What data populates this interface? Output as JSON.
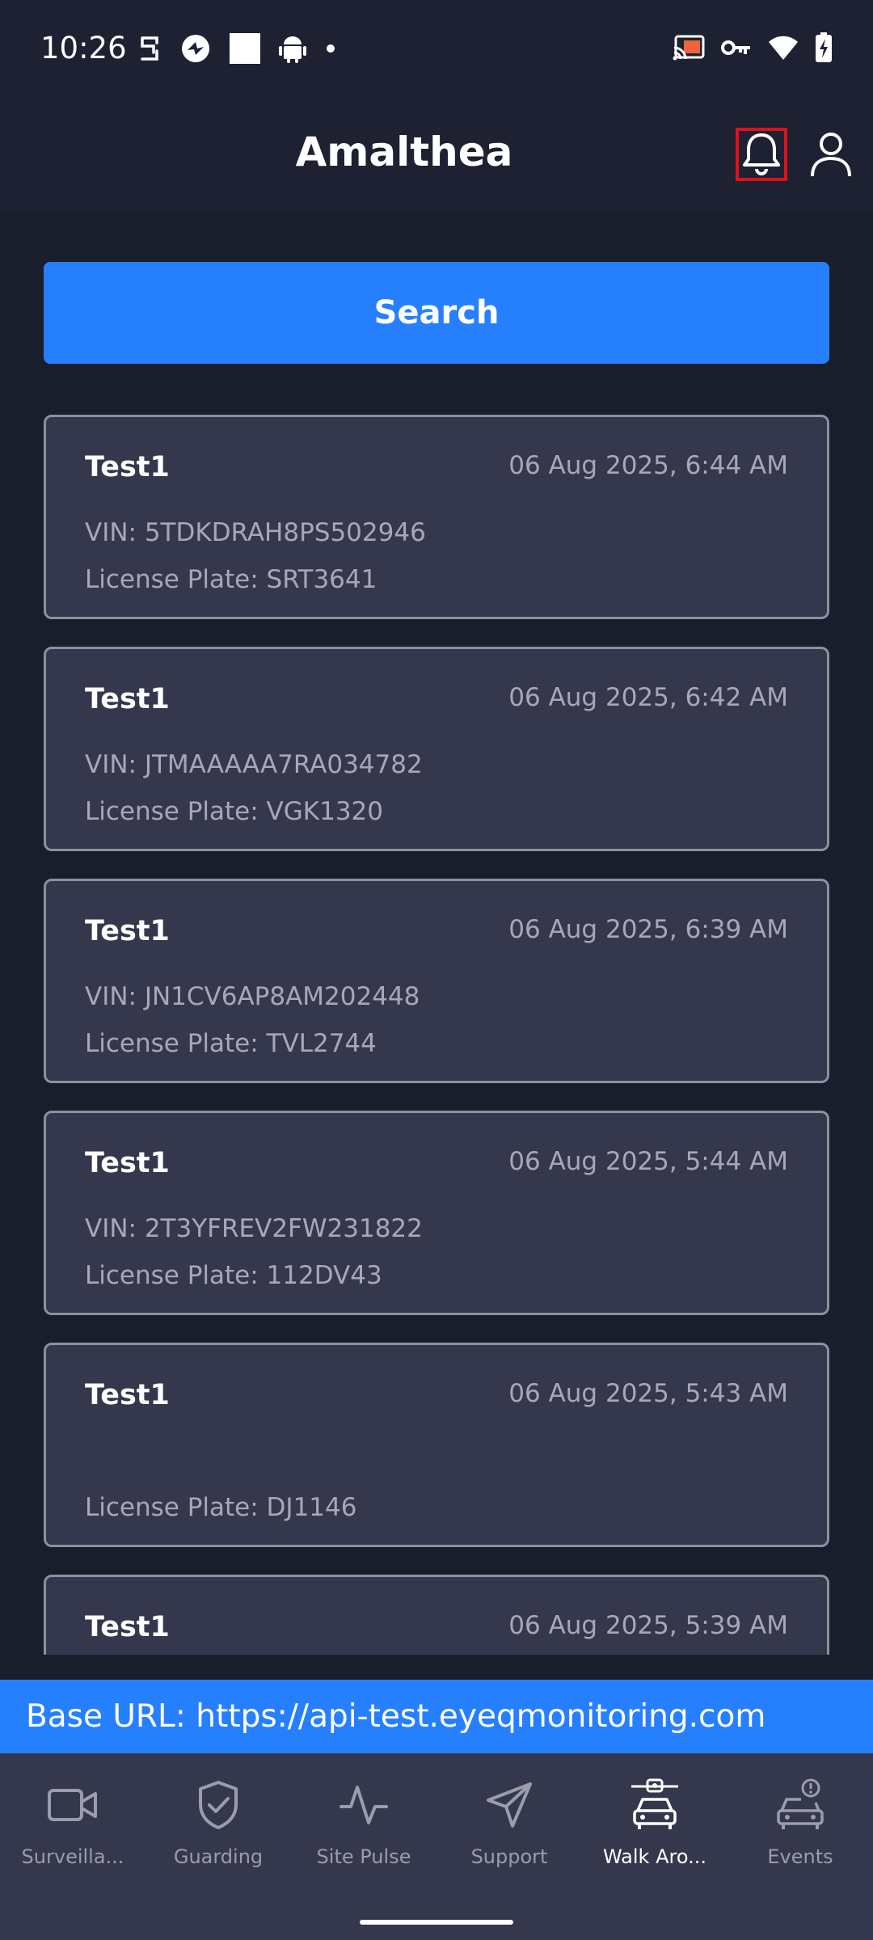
{
  "status_bar": {
    "time": "10:26",
    "left_icons": [
      "notification-app-icon",
      "media-app-icon",
      "square-icon",
      "android-icon",
      "dot-icon"
    ],
    "right_icons": [
      "cast-icon",
      "vpn-key-icon",
      "wifi-icon",
      "battery-charging-icon"
    ]
  },
  "header": {
    "title": "Amalthea",
    "bell_icon": "bell-icon",
    "profile_icon": "profile-icon",
    "highlight_color": "#e0101a"
  },
  "search": {
    "label": "Search"
  },
  "events": [
    {
      "title": "Test1",
      "time": "06 Aug 2025, 6:44 AM",
      "vin": "VIN: 5TDKDRAH8PS502946",
      "plate": "License Plate: SRT3641"
    },
    {
      "title": "Test1",
      "time": "06 Aug 2025, 6:42 AM",
      "vin": "VIN: JTMAAAAA7RA034782",
      "plate": "License Plate: VGK1320"
    },
    {
      "title": "Test1",
      "time": "06 Aug 2025, 6:39 AM",
      "vin": "VIN: JN1CV6AP8AM202448",
      "plate": "License Plate: TVL2744"
    },
    {
      "title": "Test1",
      "time": "06 Aug 2025, 5:44 AM",
      "vin": "VIN: 2T3YFREV2FW231822",
      "plate": "License Plate: 112DV43"
    },
    {
      "title": "Test1",
      "time": "06 Aug 2025, 5:43 AM",
      "vin": "",
      "plate": "License Plate: DJ1146"
    },
    {
      "title": "Test1",
      "time": "06 Aug 2025, 5:39 AM",
      "vin": "",
      "plate": ""
    }
  ],
  "base_url": {
    "text": "Base URL: https://api-test.eyeqmonitoring.com"
  },
  "bottom_nav": [
    {
      "label": "Surveilla...",
      "icon": "video-camera-icon",
      "active": false
    },
    {
      "label": "Guarding",
      "icon": "shield-check-icon",
      "active": false
    },
    {
      "label": "Site Pulse",
      "icon": "pulse-icon",
      "active": false
    },
    {
      "label": "Support",
      "icon": "send-icon",
      "active": false
    },
    {
      "label": "Walk Aro...",
      "icon": "car-camera-icon",
      "active": true
    },
    {
      "label": "Events",
      "icon": "car-alert-icon",
      "active": false
    }
  ],
  "colors": {
    "background": "#1a1d2c",
    "header": "#1e2132",
    "card": "#35384d",
    "accent": "#2680fe"
  }
}
